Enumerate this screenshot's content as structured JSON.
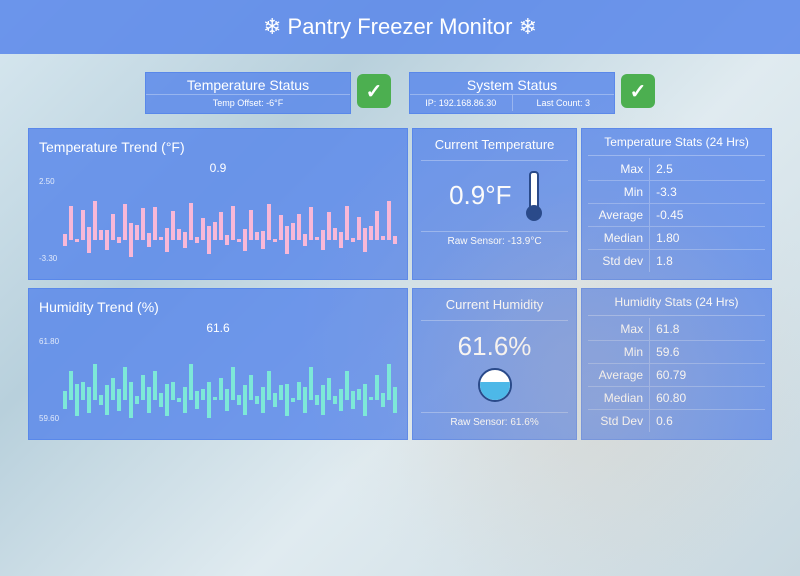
{
  "header": {
    "title": "❄ Pantry Freezer Monitor ❄"
  },
  "status": {
    "temp": {
      "title": "Temperature Status",
      "sub": "Temp Offset: -6°F"
    },
    "sys": {
      "title": "System Status",
      "ip": "IP: 192.168.86.30",
      "count": "Last Count: 3"
    }
  },
  "temp": {
    "trend_title": "Temperature Trend (°F)",
    "trend_val": "0.9",
    "axis_top": "2.50",
    "axis_bot": "-3.30",
    "current_title": "Current Temperature",
    "current_val": "0.9°F",
    "raw": "Raw Sensor: -13.9°C",
    "stats_title": "Temperature Stats (24 Hrs)",
    "stats": [
      {
        "k": "Max",
        "v": "2.5"
      },
      {
        "k": "Min",
        "v": "-3.3"
      },
      {
        "k": "Average",
        "v": "-0.45"
      },
      {
        "k": "Median",
        "v": "1.80"
      },
      {
        "k": "Std dev",
        "v": "1.8"
      }
    ]
  },
  "hum": {
    "trend_title": "Humidity Trend (%)",
    "trend_val": "61.6",
    "axis_top": "61.80",
    "axis_bot": "59.60",
    "current_title": "Current Humidity",
    "current_val": "61.6%",
    "raw": "Raw Sensor: 61.6%",
    "stats_title": "Humidity Stats (24 Hrs)",
    "stats": [
      {
        "k": "Max",
        "v": "61.8"
      },
      {
        "k": "Min",
        "v": "59.6"
      },
      {
        "k": "Average",
        "v": "60.79"
      },
      {
        "k": "Median",
        "v": "60.80"
      },
      {
        "k": "Std Dev",
        "v": "0.6"
      }
    ]
  },
  "chart_data": [
    {
      "type": "bar",
      "title": "Temperature Trend (°F)",
      "ylim": [
        -3.3,
        2.5
      ],
      "ylabel": "°F",
      "current": 0.9,
      "values": [
        -1.2,
        2.1,
        -0.5,
        1.8,
        -2.3,
        2.4,
        0.3,
        -1.8,
        1.5,
        -0.9,
        2.2,
        -2.8,
        0.7,
        1.9,
        -1.4,
        2.0,
        -0.2,
        -2.1,
        1.7,
        0.4,
        -1.6,
        2.3,
        -0.8,
        1.2,
        -2.5,
        0.9,
        1.6,
        -1.1,
        2.1,
        -0.4,
        -2.0,
        1.8,
        0.2,
        -1.7,
        2.2,
        -0.6,
        1.4,
        -2.4,
        0.8,
        1.5,
        -1.3,
        2.0,
        -0.3,
        -1.9,
        1.6,
        0.5,
        -1.5,
        2.1,
        -0.7,
        1.3,
        -2.2,
        0.6,
        1.7,
        -0.1,
        2.4,
        -1.0
      ]
    },
    {
      "type": "bar",
      "title": "Humidity Trend (%)",
      "ylim": [
        59.6,
        61.8
      ],
      "ylabel": "%",
      "current": 61.6,
      "values": [
        60.2,
        61.5,
        59.8,
        61.2,
        60.0,
        61.7,
        60.4,
        59.9,
        61.3,
        60.1,
        61.6,
        59.7,
        60.5,
        61.4,
        60.0,
        61.5,
        60.3,
        59.8,
        61.2,
        60.6,
        60.0,
        61.7,
        60.2,
        61.0,
        59.7,
        60.7,
        61.3,
        60.1,
        61.6,
        60.4,
        59.9,
        61.4,
        60.5,
        60.0,
        61.5,
        60.3,
        61.1,
        59.8,
        60.6,
        61.2,
        60.0,
        61.6,
        60.4,
        59.9,
        61.3,
        60.5,
        60.1,
        61.5,
        60.2,
        61.0,
        59.8,
        60.7,
        61.4,
        60.3,
        61.7,
        60.0
      ]
    }
  ]
}
